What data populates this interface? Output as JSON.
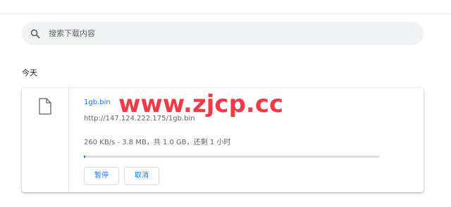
{
  "search": {
    "placeholder": "搜索下载内容",
    "icon": "search-icon"
  },
  "section": {
    "label": "今天"
  },
  "download": {
    "file_name": "1gb.bin",
    "url": "http://147.124.222.175/1gb.bin",
    "status": "260 KB/s - 3.8 MB，共 1.0 GB，还剩 1 小时",
    "progress_fraction": 0.004,
    "file_icon": "file-icon",
    "pause_label": "暂停",
    "cancel_label": "取消"
  },
  "watermark": {
    "text": "www.zjcp.cc",
    "color": "#f23b47"
  },
  "colors": {
    "accent": "#1a73e8",
    "search_bg": "#f1f3f4",
    "muted_text": "#5f6368"
  }
}
